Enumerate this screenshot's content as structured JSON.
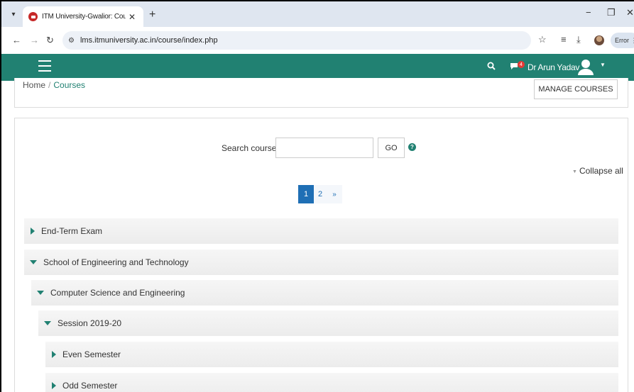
{
  "browser": {
    "tab_title": "ITM University-Gwalior: Courses",
    "url": "lms.itmuniversity.ac.in/course/index.php",
    "error_label": "Error"
  },
  "navbar": {
    "username": "Dr Arun Yadav",
    "message_count": "4"
  },
  "breadcrumb": {
    "home": "Home",
    "separator": "/",
    "courses": "Courses"
  },
  "manage_button": "MANAGE COURSES",
  "search": {
    "label": "Search courses",
    "value": "",
    "go_label": "GO"
  },
  "collapse_all": "Collapse all",
  "pagination": {
    "pages": [
      "1",
      "2"
    ],
    "next": "»"
  },
  "categories": [
    {
      "label": "End-Term Exam",
      "expanded": false
    },
    {
      "label": "School of Engineering and Technology",
      "expanded": true
    },
    {
      "label": "Computer Science and Engineering",
      "expanded": true
    },
    {
      "label": "Session 2019-20",
      "expanded": true
    },
    {
      "label": "Even Semester",
      "expanded": false
    },
    {
      "label": "Odd Semester",
      "expanded": false
    }
  ],
  "colors": {
    "navbar": "#218172",
    "accent": "#218172",
    "page_active": "#1f6fb5"
  }
}
